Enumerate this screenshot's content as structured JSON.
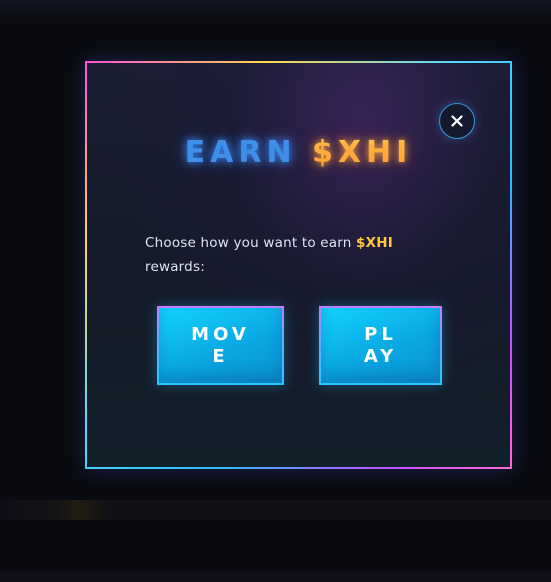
{
  "modal": {
    "title_part1": "EARN",
    "title_part2": "$XHI",
    "prompt_text": "Choose how you want to earn ",
    "prompt_token": "$XHI",
    "prompt_suffix": " rewards:",
    "close_label": "×",
    "options": {
      "move_label": "MOVE",
      "play_label": "PLAY"
    }
  },
  "colors": {
    "title_earn": "#3f8fe8",
    "title_token": "#ffb938",
    "button_fill": "#0aa8e3",
    "token_text": "#ffc83a"
  },
  "icons": {
    "close": "close-icon"
  }
}
